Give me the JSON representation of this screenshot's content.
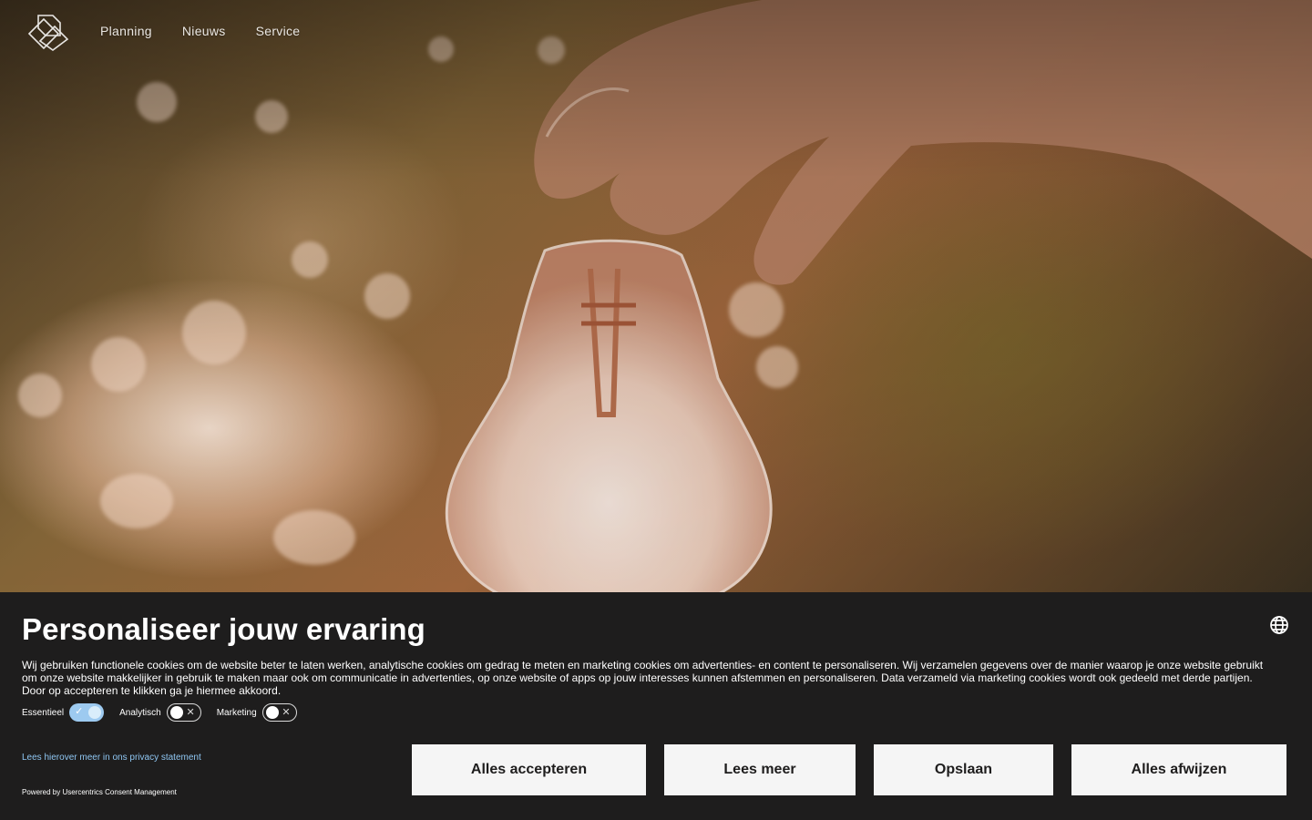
{
  "nav": {
    "links": [
      "Planning",
      "Nieuws",
      "Service"
    ]
  },
  "icons": {
    "logo": "brand-logo-icon",
    "language": "globe-icon"
  },
  "consent": {
    "title": "Personaliseer jouw ervaring",
    "body_line1": "Wij gebruiken functionele cookies om de website beter te laten werken, analytische cookies om gedrag te meten en marketing cookies om advertenties- en content te personaliseren. Wij verzamelen gegevens over de manier waarop je onze website gebruikt",
    "body_line2": "om onze website makkelijker in gebruik te maken maar ook om communicatie in advertenties, op onze website of apps op jouw interesses kunnen afstemmen en personaliseren. Data verzameld via marketing cookies wordt ook gedeeld met derde partijen.",
    "body_line3": "Door op accepteren te klikken ga je hiermee akkoord.",
    "toggles": [
      {
        "label": "Essentieel",
        "state": "on",
        "mark": "✓"
      },
      {
        "label": "Analytisch",
        "state": "off",
        "mark": "✕"
      },
      {
        "label": "Marketing",
        "state": "off",
        "mark": "✕"
      }
    ],
    "privacy_link": "Lees hierover meer in ons privacy statement",
    "powered_by": "Powered by Usercentrics Consent Management",
    "buttons": {
      "accept_all": "Alles accepteren",
      "read_more": "Lees meer",
      "save": "Opslaan",
      "deny_all": "Alles afwijzen"
    }
  },
  "colors": {
    "banner_bg": "#1e1d1d",
    "button_bg": "#f5f5f5",
    "toggle_on": "#9dcaf0",
    "link": "#8fc6f2"
  }
}
